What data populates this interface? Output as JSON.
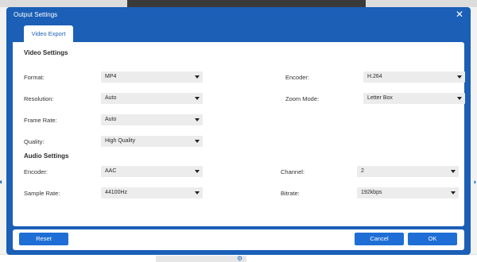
{
  "dialog": {
    "title": "Output Settings",
    "tab": "Video Export"
  },
  "video_settings": {
    "title": "Video Settings",
    "format": {
      "label": "Format:",
      "value": "MP4"
    },
    "encoder": {
      "label": "Encoder:",
      "value": "H.264"
    },
    "resolution": {
      "label": "Resolution:",
      "value": "Auto"
    },
    "zoom_mode": {
      "label": "Zoom Mode:",
      "value": "Letter Box"
    },
    "frame_rate": {
      "label": "Frame Rate:",
      "value": "Auto"
    },
    "quality": {
      "label": "Quality:",
      "value": "High Quality"
    }
  },
  "audio_settings": {
    "title": "Audio Settings",
    "encoder": {
      "label": "Encoder:",
      "value": "AAC"
    },
    "channel": {
      "label": "Channel:",
      "value": "2"
    },
    "sample_rate": {
      "label": "Sample Rate:",
      "value": "44100Hz"
    },
    "bitrate": {
      "label": "Bitrate:",
      "value": "192kbps"
    }
  },
  "footer": {
    "reset": "Reset",
    "cancel": "Cancel",
    "ok": "OK"
  },
  "colors": {
    "dialog_blue": "#1b5fb6",
    "button_blue": "#1e6ed6",
    "field_gray": "#ececec"
  },
  "icons": {
    "close": "close-icon",
    "dropdown": "chevron-down-icon"
  }
}
